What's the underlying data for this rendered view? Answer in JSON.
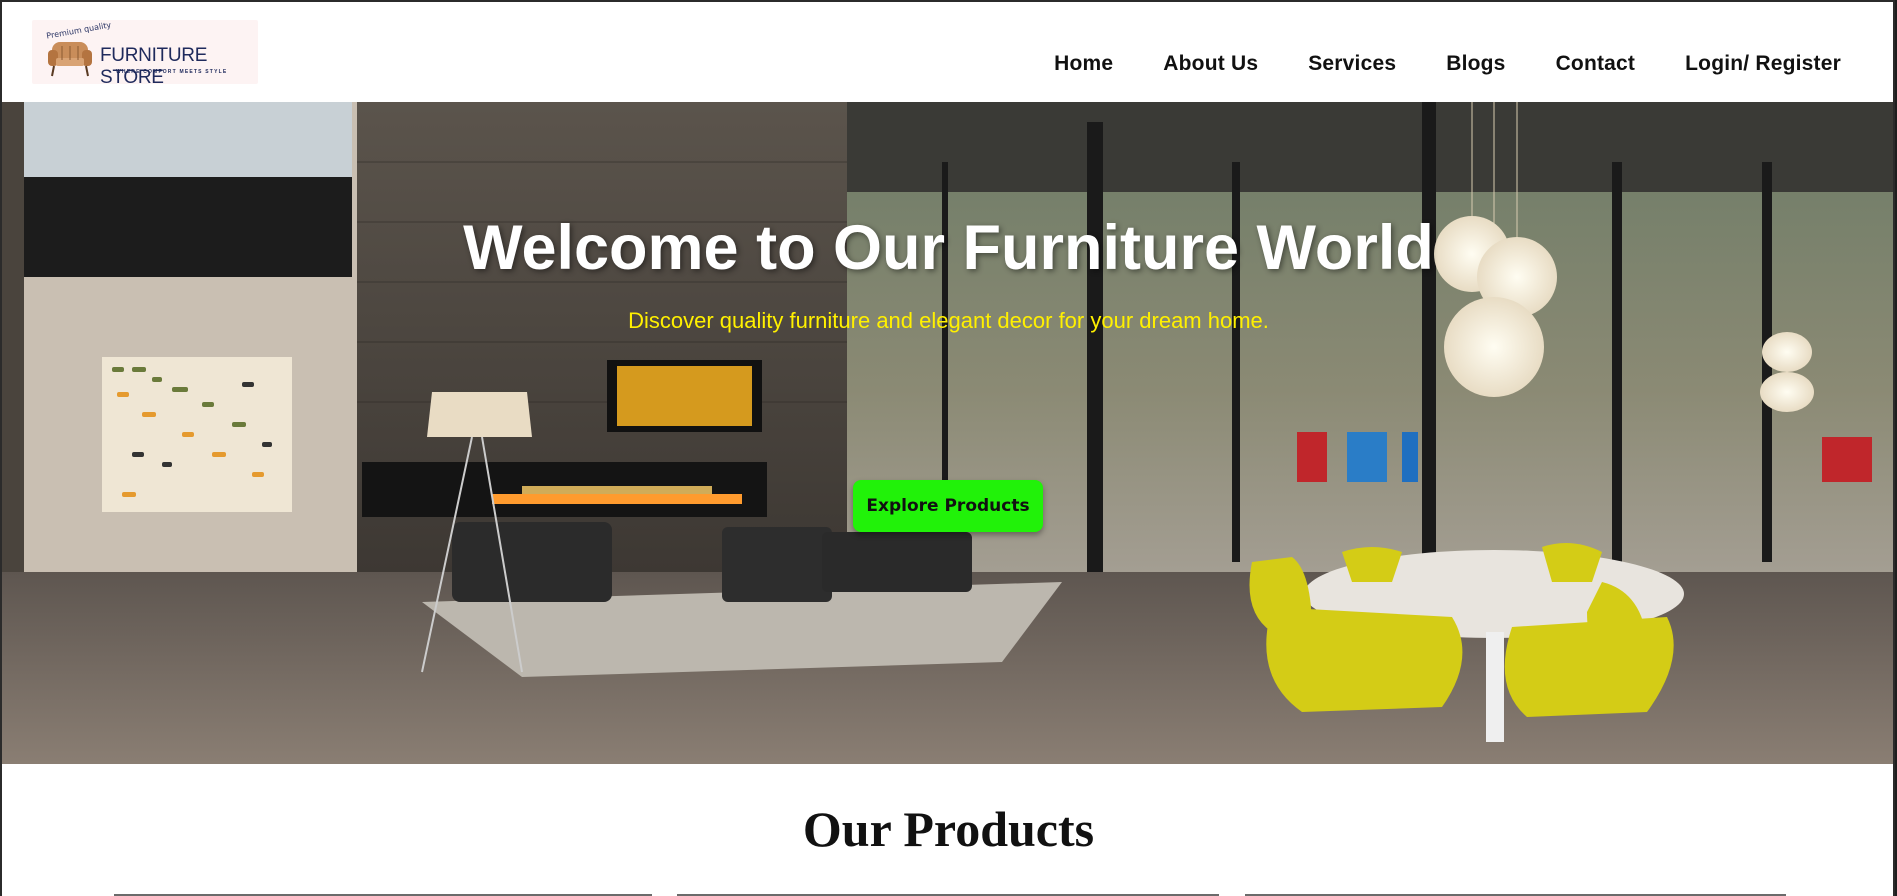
{
  "header": {
    "logo": {
      "tagline": "Premium quality",
      "brand": "FURNITURE STORE",
      "slogan": "WHERE COMFORT MEETS STYLE"
    },
    "nav": {
      "home": "Home",
      "about": "About Us",
      "services": "Services",
      "blogs": "Blogs",
      "contact": "Contact",
      "login": "Login/ Register"
    }
  },
  "hero": {
    "title": "Welcome to Our Furniture World",
    "subtitle": "Discover quality furniture and elegant decor for your dream home.",
    "cta_label": "Explore Products"
  },
  "products": {
    "title": "Our Products"
  },
  "colors": {
    "cta": "#21f209",
    "subtitle": "#fff000",
    "brand": "#1f2a5c"
  }
}
